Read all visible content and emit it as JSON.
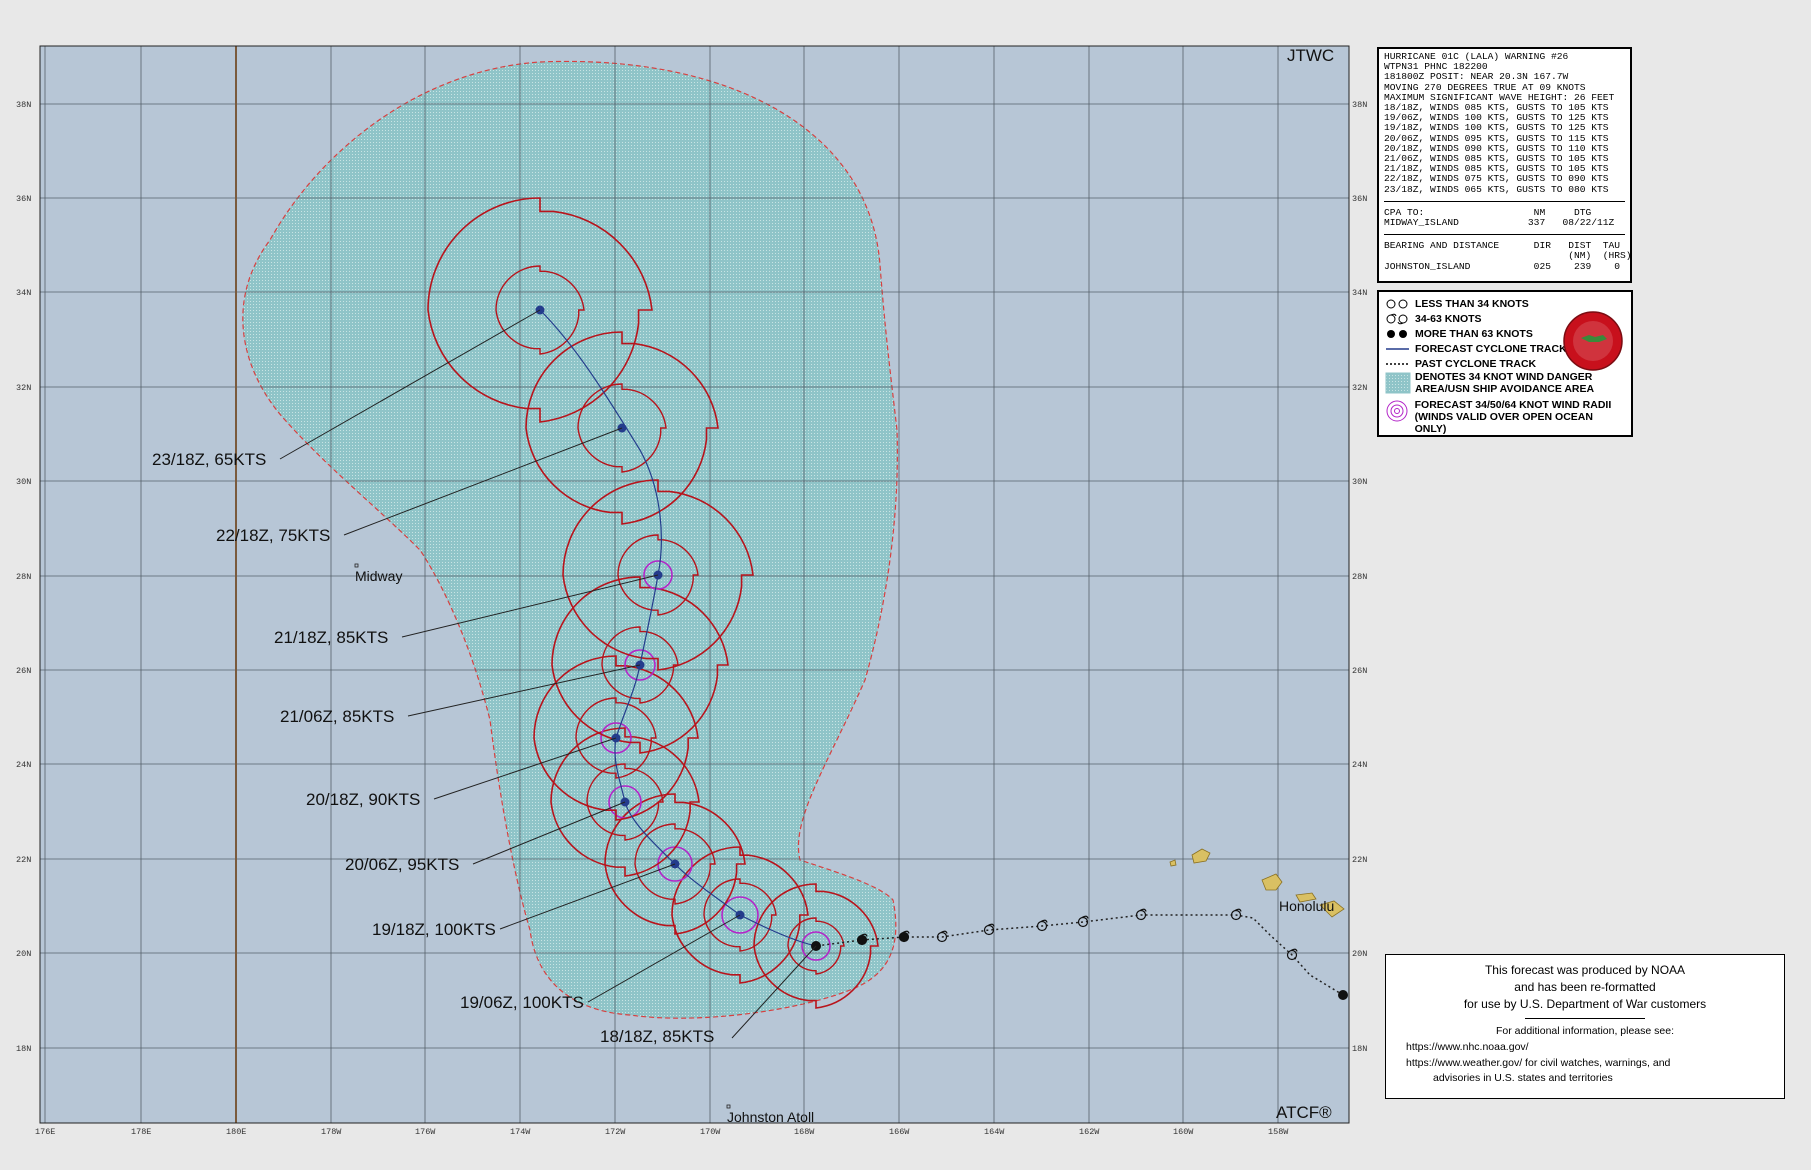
{
  "map": {
    "brand_top": "JTWC",
    "brand_bottom": "ATCF®",
    "lat_labels": [
      "38N",
      "36N",
      "34N",
      "32N",
      "30N",
      "28N",
      "26N",
      "24N",
      "22N",
      "20N",
      "18N"
    ],
    "lon_labels": [
      "176E",
      "178E",
      "180E",
      "178W",
      "176W",
      "174W",
      "172W",
      "170W",
      "168W",
      "166W",
      "164W",
      "162W",
      "160W",
      "158W"
    ],
    "places": [
      {
        "name": "Midway"
      },
      {
        "name": "Johnston Atoll"
      },
      {
        "name": "Honolulu"
      }
    ],
    "forecast_labels": [
      {
        "text": "23/18Z,  65KTS"
      },
      {
        "text": "22/18Z,  75KTS"
      },
      {
        "text": "21/18Z,  85KTS"
      },
      {
        "text": "21/06Z,  85KTS"
      },
      {
        "text": "20/18Z,  90KTS"
      },
      {
        "text": "20/06Z,  95KTS"
      },
      {
        "text": "19/18Z, 100KTS"
      },
      {
        "text": "19/06Z, 100KTS"
      },
      {
        "text": "18/18Z,  85KTS"
      }
    ]
  },
  "warning": {
    "lines": [
      "HURRICANE 01C (LALA) WARNING #26",
      "WTPN31 PHNC 182200",
      "181800Z POSIT: NEAR 20.3N 167.7W",
      "MOVING 270 DEGREES TRUE AT 09 KNOTS",
      "MAXIMUM SIGNIFICANT WAVE HEIGHT: 26 FEET",
      "18/18Z, WINDS 085 KTS, GUSTS TO 105 KTS",
      "19/06Z, WINDS 100 KTS, GUSTS TO 125 KTS",
      "19/18Z, WINDS 100 KTS, GUSTS TO 125 KTS",
      "20/06Z, WINDS 095 KTS, GUSTS TO 115 KTS",
      "20/18Z, WINDS 090 KTS, GUSTS TO 110 KTS",
      "21/06Z, WINDS 085 KTS, GUSTS TO 105 KTS",
      "21/18Z, WINDS 085 KTS, GUSTS TO 105 KTS",
      "22/18Z, WINDS 075 KTS, GUSTS TO 090 KTS",
      "23/18Z, WINDS 065 KTS, GUSTS TO 080 KTS"
    ],
    "cpa_header": "CPA TO:                   NM     DTG",
    "cpa_row": "MIDWAY_ISLAND            337   08/22/11Z",
    "bearing_header": "BEARING AND DISTANCE      DIR   DIST  TAU",
    "bearing_sub": "                                (NM)  (HRS)",
    "bearing_row": "JOHNSTON_ISLAND           025    239    0"
  },
  "legend": {
    "items": [
      "LESS THAN 34 KNOTS",
      "34-63 KNOTS",
      "MORE THAN 63 KNOTS",
      "FORECAST CYCLONE TRACK",
      "PAST CYCLONE TRACK",
      "DENOTES 34 KNOT WIND DANGER",
      "AREA/USN SHIP AVOIDANCE AREA",
      "FORECAST 34/50/64 KNOT WIND RADII",
      "(WINDS VALID OVER OPEN OCEAN ONLY)"
    ]
  },
  "noaa": {
    "line1": "This forecast was produced by NOAA",
    "line2": "and has been re-formatted",
    "line3": "for use by U.S. Department of War customers",
    "info": "For additional information, please see:",
    "url1": "https://www.nhc.noaa.gov/",
    "url2": "https://www.weather.gov/ for civil watches, warnings, and",
    "url3": "advisories in U.S. states and territories"
  },
  "colors": {
    "ocean": "#b7c6d6",
    "danger_fill": "#8fc4c8",
    "wind34": "#b8141c",
    "wind64": "#b326c8",
    "forecast_track": "#243c8c",
    "dateline": "#7a5a3c"
  }
}
